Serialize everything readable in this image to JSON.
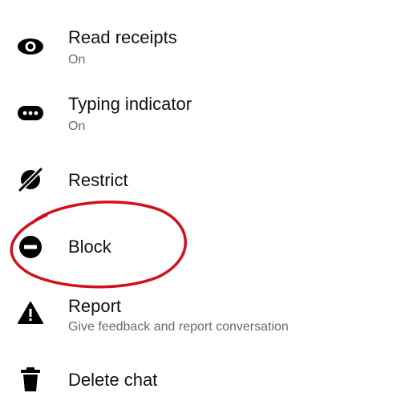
{
  "menu": {
    "read_receipts": {
      "label": "Read receipts",
      "subtitle": "On",
      "icon": "eye-icon"
    },
    "typing_indicator": {
      "label": "Typing indicator",
      "subtitle": "On",
      "icon": "ellipsis-bubble-icon"
    },
    "restrict": {
      "label": "Restrict",
      "icon": "restrict-icon"
    },
    "block": {
      "label": "Block",
      "icon": "block-icon"
    },
    "report": {
      "label": "Report",
      "subtitle": "Give feedback and report conversation",
      "icon": "warning-icon"
    },
    "delete_chat": {
      "label": "Delete chat",
      "icon": "trash-icon"
    }
  },
  "colors": {
    "text": "#111111",
    "subtext": "#6b6b6b",
    "icon": "#000000",
    "annotation": "#d0101e"
  }
}
